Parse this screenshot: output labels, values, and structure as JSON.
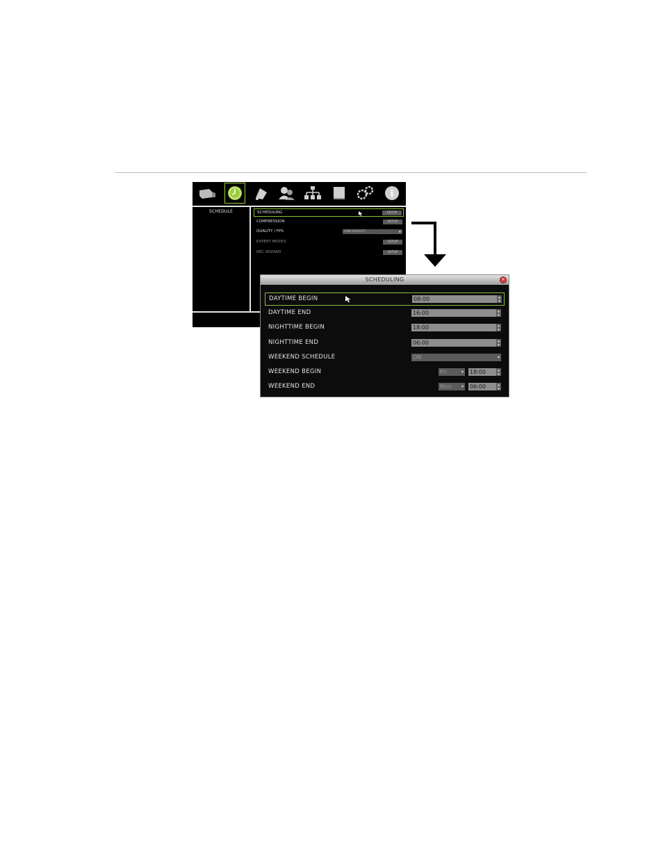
{
  "menu": {
    "toolbar_icons": [
      "camera-icon",
      "clock-icon",
      "bell-icon",
      "users-icon",
      "network-icon",
      "monitor-icon",
      "gears-icon",
      "info-icon"
    ],
    "active_icon": "clock-icon",
    "left_title": "SCHEDULE",
    "items": [
      {
        "label": "SCHEDULING",
        "button": "SETUP"
      },
      {
        "label": "COMPRESSION",
        "button": "SETUP"
      },
      {
        "label": "QUALITY / FPS",
        "select": "LOW QUALITY"
      },
      {
        "label": "EXPERT MODES",
        "button": "SETUP"
      },
      {
        "label": "REC WIZARD",
        "button": "SETUP"
      }
    ]
  },
  "dialog": {
    "title": "SCHEDULING",
    "rows": [
      {
        "label": "DAYTIME BEGIN",
        "value": "08:00"
      },
      {
        "label": "DAYTIME END",
        "value": "16:00"
      },
      {
        "label": "NIGHTTIME BEGIN",
        "value": "18:00"
      },
      {
        "label": "NIGHTTIME END",
        "value": "06:00"
      },
      {
        "label": "WEEKEND SCHEDULE",
        "value": "ON"
      },
      {
        "label": "WEEKEND BEGIN",
        "day": "Fri",
        "value": "18:00"
      },
      {
        "label": "WEEKEND END",
        "day": "Mon",
        "value": "06:00"
      }
    ]
  },
  "colors": {
    "selection": "#8cbf3a",
    "close": "#d23b3b"
  }
}
